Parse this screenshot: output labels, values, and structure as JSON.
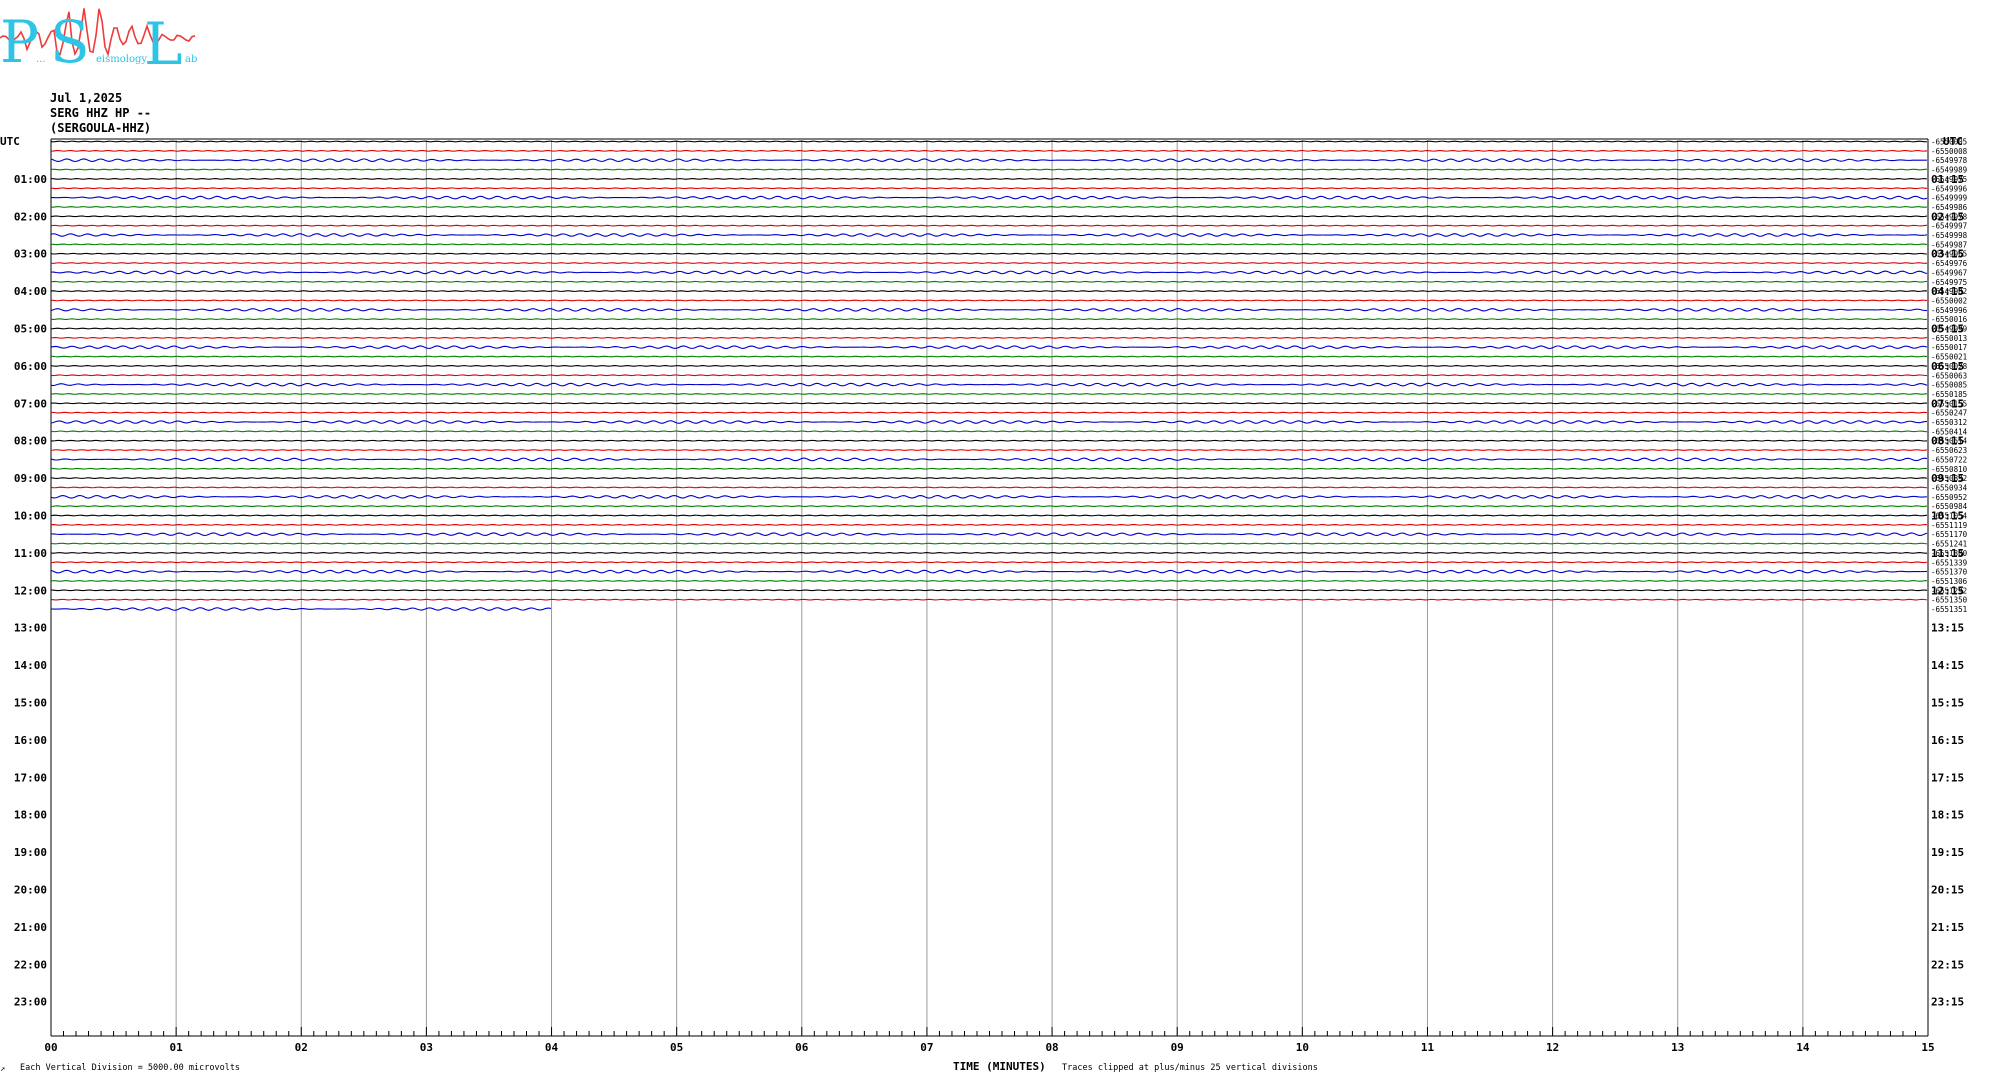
{
  "logo": {
    "big_letters": [
      "P",
      "S",
      "L"
    ],
    "words": [
      "...",
      "eismology",
      "ab"
    ],
    "colors": {
      "letters": "#2ec4e6",
      "wave": "#ef3b3b"
    }
  },
  "header": {
    "date": "Jul 1,2025",
    "channel": "SERG HHZ HP --",
    "station": "(SERGOULA-HHZ)"
  },
  "axes": {
    "left_title": "UTC",
    "right_title": "UTC",
    "left_hours": [
      "01:00",
      "02:00",
      "03:00",
      "04:00",
      "05:00",
      "06:00",
      "07:00",
      "08:00",
      "09:00",
      "10:00",
      "11:00",
      "12:00",
      "13:00",
      "14:00",
      "15:00",
      "16:00",
      "17:00",
      "18:00",
      "19:00",
      "20:00",
      "21:00",
      "22:00",
      "23:00"
    ],
    "right_hours": [
      "01:15",
      "02:15",
      "03:15",
      "04:15",
      "05:15",
      "06:15",
      "07:15",
      "08:15",
      "09:15",
      "10:15",
      "11:15",
      "12:15",
      "13:15",
      "14:15",
      "15:15",
      "16:15",
      "17:15",
      "18:15",
      "19:15",
      "20:15",
      "21:15",
      "22:15",
      "23:15"
    ],
    "x_ticks": [
      "00",
      "01",
      "02",
      "03",
      "04",
      "05",
      "06",
      "07",
      "08",
      "09",
      "10",
      "11",
      "12",
      "13",
      "14",
      "15"
    ],
    "x_title": "TIME (MINUTES)"
  },
  "footer": {
    "mark": "↗",
    "scale_note": "Each Vertical Division = 5000.00 microvolts",
    "clip_note": "Traces clipped at plus/minus 25 vertical divisions"
  },
  "chart_data": {
    "type": "line",
    "title": "",
    "xlabel": "TIME (MINUTES)",
    "ylabel": "UTC",
    "xlim": [
      0,
      15
    ],
    "trace_interval_minutes": 15,
    "trace_colors": [
      "#000000",
      "#e00000",
      "#0000cc",
      "#008000"
    ],
    "traces": [
      {
        "start": "00:00",
        "offset": "-6550005",
        "end_minute": 15
      },
      {
        "start": "00:15",
        "offset": "-6550008",
        "end_minute": 15
      },
      {
        "start": "00:30",
        "offset": "-6549978",
        "end_minute": 15
      },
      {
        "start": "00:45",
        "offset": "-6549989",
        "end_minute": 15
      },
      {
        "start": "01:00",
        "offset": "-6549975",
        "end_minute": 15
      },
      {
        "start": "01:15",
        "offset": "-6549996",
        "end_minute": 15
      },
      {
        "start": "01:30",
        "offset": "-6549999",
        "end_minute": 15
      },
      {
        "start": "01:45",
        "offset": "-6549986",
        "end_minute": 15
      },
      {
        "start": "02:00",
        "offset": "-6549978",
        "end_minute": 15
      },
      {
        "start": "02:15",
        "offset": "-6549997",
        "end_minute": 15
      },
      {
        "start": "02:30",
        "offset": "-6549998",
        "end_minute": 15
      },
      {
        "start": "02:45",
        "offset": "-6549987",
        "end_minute": 15
      },
      {
        "start": "03:00",
        "offset": "-6549965",
        "end_minute": 15
      },
      {
        "start": "03:15",
        "offset": "-6549976",
        "end_minute": 15
      },
      {
        "start": "03:30",
        "offset": "-6549967",
        "end_minute": 15
      },
      {
        "start": "03:45",
        "offset": "-6549975",
        "end_minute": 15
      },
      {
        "start": "04:00",
        "offset": "-6549982",
        "end_minute": 15
      },
      {
        "start": "04:15",
        "offset": "-6550002",
        "end_minute": 15
      },
      {
        "start": "04:30",
        "offset": "-6549996",
        "end_minute": 15
      },
      {
        "start": "04:45",
        "offset": "-6550016",
        "end_minute": 15
      },
      {
        "start": "05:00",
        "offset": "-6549999",
        "end_minute": 15
      },
      {
        "start": "05:15",
        "offset": "-6550013",
        "end_minute": 15
      },
      {
        "start": "05:30",
        "offset": "-6550017",
        "end_minute": 15
      },
      {
        "start": "05:45",
        "offset": "-6550021",
        "end_minute": 15
      },
      {
        "start": "06:00",
        "offset": "-6550028",
        "end_minute": 15
      },
      {
        "start": "06:15",
        "offset": "-6550063",
        "end_minute": 15
      },
      {
        "start": "06:30",
        "offset": "-6550085",
        "end_minute": 15
      },
      {
        "start": "06:45",
        "offset": "-6550185",
        "end_minute": 15
      },
      {
        "start": "07:00",
        "offset": "-6550155",
        "end_minute": 15
      },
      {
        "start": "07:15",
        "offset": "-6550247",
        "end_minute": 15
      },
      {
        "start": "07:30",
        "offset": "-6550312",
        "end_minute": 15
      },
      {
        "start": "07:45",
        "offset": "-6550414",
        "end_minute": 15
      },
      {
        "start": "08:00",
        "offset": "-6550514",
        "end_minute": 15
      },
      {
        "start": "08:15",
        "offset": "-6550623",
        "end_minute": 15
      },
      {
        "start": "08:30",
        "offset": "-6550722",
        "end_minute": 15
      },
      {
        "start": "08:45",
        "offset": "-6550810",
        "end_minute": 15
      },
      {
        "start": "09:00",
        "offset": "-6550892",
        "end_minute": 15
      },
      {
        "start": "09:15",
        "offset": "-6550934",
        "end_minute": 15
      },
      {
        "start": "09:30",
        "offset": "-6550952",
        "end_minute": 15
      },
      {
        "start": "09:45",
        "offset": "-6550984",
        "end_minute": 15
      },
      {
        "start": "10:00",
        "offset": "-6551054",
        "end_minute": 15
      },
      {
        "start": "10:15",
        "offset": "-6551119",
        "end_minute": 15
      },
      {
        "start": "10:30",
        "offset": "-6551170",
        "end_minute": 15
      },
      {
        "start": "10:45",
        "offset": "-6551241",
        "end_minute": 15
      },
      {
        "start": "11:00",
        "offset": "-6551300",
        "end_minute": 15
      },
      {
        "start": "11:15",
        "offset": "-6551339",
        "end_minute": 15
      },
      {
        "start": "11:30",
        "offset": "-6551370",
        "end_minute": 15
      },
      {
        "start": "11:45",
        "offset": "-6551306",
        "end_minute": 15
      },
      {
        "start": "12:00",
        "offset": "-6551292",
        "end_minute": 15
      },
      {
        "start": "12:15",
        "offset": "-6551350",
        "end_minute": 15
      },
      {
        "start": "12:30",
        "offset": "-6551351",
        "end_minute": 4
      }
    ]
  }
}
